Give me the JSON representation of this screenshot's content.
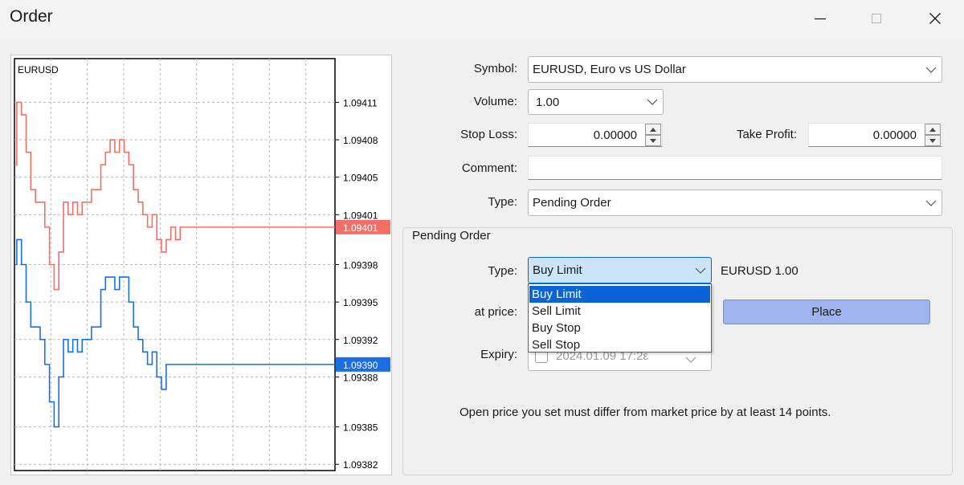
{
  "window": {
    "title": "Order",
    "minimize_icon": "minimize-icon",
    "maximize_icon": "maximize-icon",
    "close_icon": "close-icon"
  },
  "chart_data": {
    "type": "line",
    "title": "EURUSD",
    "ylim": [
      1.093815,
      1.094145
    ],
    "y_ticks": [
      "1.09411",
      "1.09408",
      "1.09405",
      "1.09401",
      "1.09398",
      "1.09395",
      "1.09392",
      "1.09388",
      "1.09385",
      "1.09382"
    ],
    "y_tick_values": [
      1.09411,
      1.09408,
      1.09405,
      1.09402,
      1.09398,
      1.09395,
      1.09392,
      1.09389,
      1.09385,
      1.09382
    ],
    "grid": true,
    "series": [
      {
        "color": "#f07068",
        "current_label": "1.09401",
        "current_value": 1.09401,
        "values": [
          1.09406,
          1.09411,
          1.0941,
          1.09407,
          1.09404,
          1.09403,
          1.09403,
          1.09401,
          1.09398,
          1.09396,
          1.09399,
          1.09403,
          1.09402,
          1.09403,
          1.09402,
          1.09403,
          1.09403,
          1.09404,
          1.09404,
          1.09406,
          1.09407,
          1.09408,
          1.09407,
          1.09408,
          1.09407,
          1.09406,
          1.09404,
          1.09403,
          1.09402,
          1.09401,
          1.09402,
          1.094,
          1.09399,
          1.094,
          1.09401,
          1.094,
          1.09401,
          1.09401,
          1.09401,
          1.09401,
          1.09401,
          1.09401,
          1.09401,
          1.09401,
          1.09401,
          1.09401,
          1.09401,
          1.09401,
          1.09401,
          1.09401,
          1.09401
        ]
      },
      {
        "color": "#1a6fe6",
        "current_label": "1.09390",
        "current_value": 1.0939,
        "values": [
          1.09398,
          1.094,
          1.09398,
          1.09395,
          1.09393,
          1.09393,
          1.09392,
          1.0939,
          1.09387,
          1.09385,
          1.09389,
          1.09392,
          1.09391,
          1.09392,
          1.09391,
          1.09392,
          1.09392,
          1.09393,
          1.09393,
          1.09396,
          1.09397,
          1.09397,
          1.09396,
          1.09397,
          1.09397,
          1.09395,
          1.09393,
          1.09392,
          1.09391,
          1.0939,
          1.09391,
          1.09389,
          1.09388,
          1.0939,
          1.0939,
          1.0939,
          1.0939,
          1.0939,
          1.0939,
          1.0939,
          1.0939,
          1.0939,
          1.0939,
          1.0939,
          1.0939,
          1.0939,
          1.0939,
          1.0939,
          1.0939,
          1.0939,
          1.0939
        ]
      }
    ]
  },
  "form": {
    "symbol_label": "Symbol:",
    "symbol_value": "EURUSD, Euro vs US Dollar",
    "volume_label": "Volume:",
    "volume_value": "1.00",
    "stop_loss_label": "Stop Loss:",
    "stop_loss_value": "0.00000",
    "take_profit_label": "Take Profit:",
    "take_profit_value": "0.00000",
    "comment_label": "Comment:",
    "comment_value": "",
    "type_label": "Type:",
    "type_value": "Pending Order"
  },
  "pending": {
    "group_title": "Pending Order",
    "type_label": "Type:",
    "type_value": "Buy Limit",
    "summary": "EURUSD 1.00",
    "at_price_label": "at price:",
    "place_label": "Place",
    "expiry_label": "Expiry:",
    "expiry_value": "2024.01.09 17:2ε",
    "options": [
      "Buy Limit",
      "Sell Limit",
      "Buy Stop",
      "Sell Stop"
    ],
    "selected_index": 0,
    "info_text": "Open price you set must differ from market price by at least 14 points."
  },
  "colors": {
    "accent": "#0a64d6",
    "place_button": "#9fb4ee",
    "ask_line": "#f07068",
    "bid_line": "#1a6fe6"
  }
}
